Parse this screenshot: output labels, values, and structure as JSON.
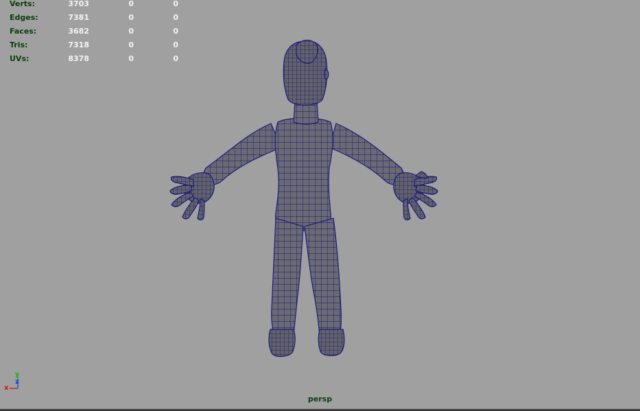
{
  "hud": {
    "rows": [
      {
        "label": "Verts:",
        "total": "3703",
        "selected": "0",
        "component": "0"
      },
      {
        "label": "Edges:",
        "total": "7381",
        "selected": "0",
        "component": "0"
      },
      {
        "label": "Faces:",
        "total": "3682",
        "selected": "0",
        "component": "0"
      },
      {
        "label": "Tris:",
        "total": "7318",
        "selected": "0",
        "component": "0"
      },
      {
        "label": "UVs:",
        "total": "8378",
        "selected": "0",
        "component": "0"
      }
    ]
  },
  "viewport": {
    "camera_name": "persp",
    "background_color": "#a0a0a0",
    "wireframe_color": "#14146e",
    "mesh_color": "#6a6a74"
  },
  "axis_gizmo": {
    "x_label": "x",
    "y_label": "y",
    "z_label": "z",
    "x_color": "#d01010",
    "y_color": "#10b010",
    "z_color": "#1040e0"
  }
}
